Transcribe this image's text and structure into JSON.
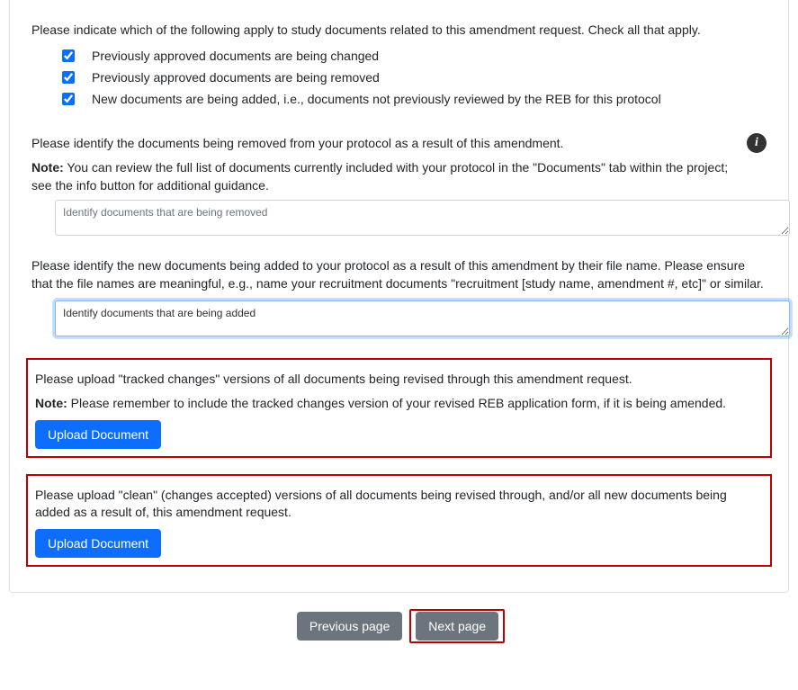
{
  "q_apply": {
    "prompt": "Please indicate which of the following apply to study documents related to this amendment request. Check all that apply.",
    "options": [
      {
        "label": "Previously approved documents are being changed",
        "checked": true
      },
      {
        "label": "Previously approved documents are being removed",
        "checked": true
      },
      {
        "label": "New documents are being added, i.e., documents not previously reviewed by the REB for this protocol",
        "checked": true
      }
    ]
  },
  "q_removed": {
    "prompt": "Please identify the documents being removed from your protocol as a result of this amendment.",
    "note_label": "Note:",
    "note_text": " You can review the full list of documents currently included with your protocol in the \"Documents\" tab within the project; see the info button for additional guidance.",
    "placeholder": "Identify documents that are being removed",
    "value": ""
  },
  "q_added": {
    "prompt": "Please identify the new documents being added to your protocol as a result of this amendment by their file name. Please ensure that the file names are meaningful, e.g., name your recruitment documents \"recruitment [study name, amendment #, etc]\" or similar.",
    "value": "Identify documents that are being added"
  },
  "upload_tracked": {
    "prompt": "Please upload \"tracked changes\" versions of all documents being revised through this amendment request.",
    "note_label": "Note:",
    "note_text": " Please remember to include the tracked changes version of your revised REB application form, if it is being amended.",
    "button": "Upload Document"
  },
  "upload_clean": {
    "prompt": "Please upload \"clean\" (changes accepted) versions of all documents being revised through, and/or all new documents being added as a result of, this amendment request.",
    "button": "Upload Document"
  },
  "nav": {
    "prev": "Previous page",
    "next": "Next page"
  },
  "icons": {
    "info_glyph": "i"
  }
}
